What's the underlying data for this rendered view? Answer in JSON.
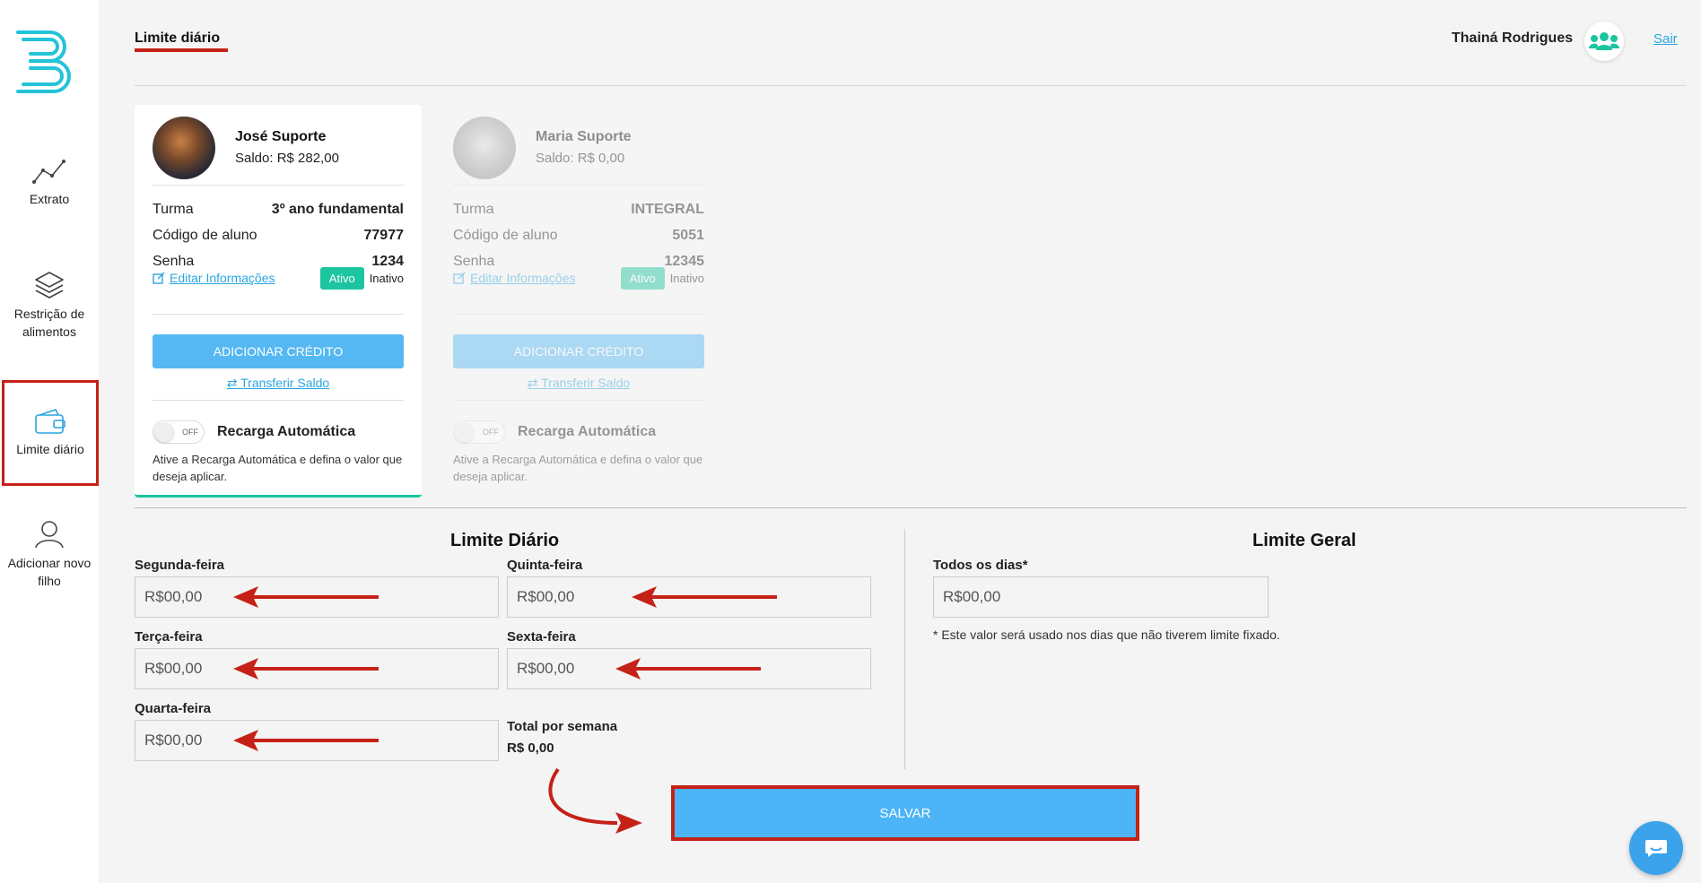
{
  "nav": {
    "extrato": "Extrato",
    "restricao": "Restrição de alimentos",
    "limite": "Limite diário",
    "adicionar": "Adicionar novo filho"
  },
  "header": {
    "title": "Limite diário",
    "user_name": "Thainá Rodrigues",
    "logout": "Sair"
  },
  "children": [
    {
      "name": "José Suporte",
      "balance": "Saldo: R$ 282,00",
      "turma_label": "Turma",
      "turma": "3º ano fundamental",
      "codigo_label": "Código de aluno",
      "codigo": "77977",
      "senha_label": "Senha",
      "senha": "1234",
      "edit": "Editar Informações",
      "ativo": "Ativo",
      "inativo": "Inativo",
      "credit": "ADICIONAR CRÉDITO",
      "transfer": "Transferir Saldo",
      "switch": "OFF",
      "recharge_title": "Recarga Automática",
      "recharge_desc": "Ative a Recarga Automática e defina o valor que deseja aplicar."
    },
    {
      "name": "Maria Suporte",
      "balance": "Saldo: R$ 0,00",
      "turma_label": "Turma",
      "turma": "INTEGRAL",
      "codigo_label": "Código de aluno",
      "codigo": "5051",
      "senha_label": "Senha",
      "senha": "12345",
      "edit": "Editar Informações",
      "ativo": "Ativo",
      "inativo": "Inativo",
      "credit": "ADICIONAR CRÉDITO",
      "transfer": "Transferir Saldo",
      "switch": "OFF",
      "recharge_title": "Recarga Automática",
      "recharge_desc": "Ative a Recarga Automática e defina o valor que deseja aplicar."
    }
  ],
  "limits": {
    "daily_title": "Limite Diário",
    "general_title": "Limite Geral",
    "days": [
      {
        "label": "Segunda-feira",
        "value": "R$00,00"
      },
      {
        "label": "Terça-feira",
        "value": "R$00,00"
      },
      {
        "label": "Quarta-feira",
        "value": "R$00,00"
      },
      {
        "label": "Quinta-feira",
        "value": "R$00,00"
      },
      {
        "label": "Sexta-feira",
        "value": "R$00,00"
      }
    ],
    "total_label": "Total por semana",
    "total_value": "R$ 0,00",
    "all_days_label": "Todos os dias*",
    "all_days_value": "R$00,00",
    "note": "* Este valor será usado nos dias que não tiverem limite fixado.",
    "save": "SALVAR"
  },
  "colors": {
    "accent": "#1cc4a0",
    "primary": "#4cb4f7",
    "highlight": "#c62117"
  }
}
